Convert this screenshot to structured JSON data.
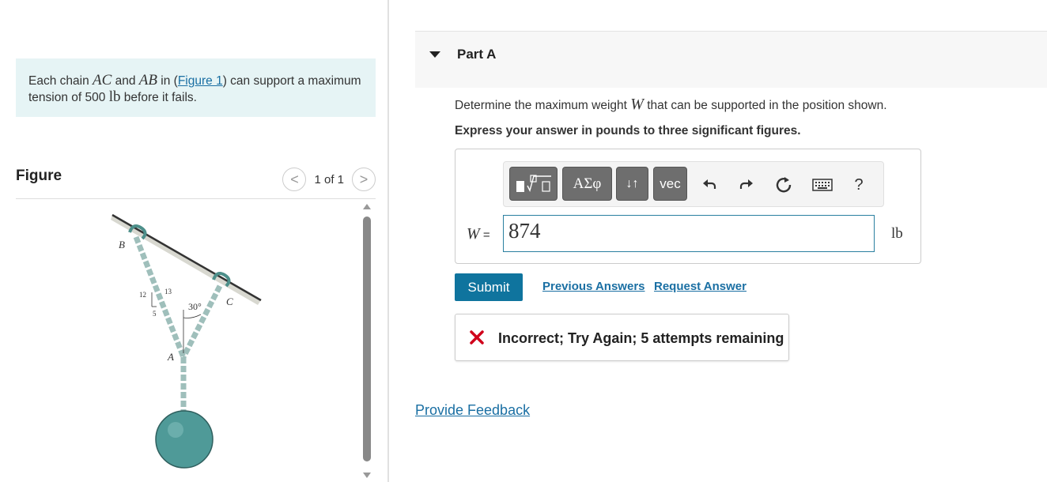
{
  "problem": {
    "text_1": "Each chain ",
    "var_ac": "AC",
    "text_2": " and ",
    "var_ab": "AB",
    "text_3": " in (",
    "figure_link": "Figure 1",
    "text_4": ") can support a maximum tension of 500 ",
    "unit": "lb",
    "text_5": " before it fails."
  },
  "figure_panel": {
    "title": "Figure",
    "pager_label": "1 of 1",
    "prev_glyph": "<",
    "next_glyph": ">",
    "labels": {
      "B": "B",
      "C": "C",
      "A": "A",
      "n12": "12",
      "n13": "13",
      "n5": "5",
      "angle": "30°"
    }
  },
  "part": {
    "title": "Part A",
    "question_1": "Determine the maximum weight ",
    "question_var": "W",
    "question_2": " that can be supported in the position shown.",
    "instruction": "Express your answer in pounds to three significant figures."
  },
  "toolbar": {
    "greek_label": "ΑΣφ",
    "arrows_label": "↓↑",
    "vec_label": "vec",
    "help_label": "?"
  },
  "answer": {
    "var": "W",
    "equals": " =",
    "value": "874",
    "unit": "lb"
  },
  "actions": {
    "submit_label": "Submit",
    "previous_answers": "Previous Answers",
    "request_answer": "Request Answer"
  },
  "feedback": {
    "message": "Incorrect; Try Again; 5 attempts remaining",
    "color": "#d0021b"
  },
  "footer": {
    "provide_feedback": "Provide Feedback"
  }
}
